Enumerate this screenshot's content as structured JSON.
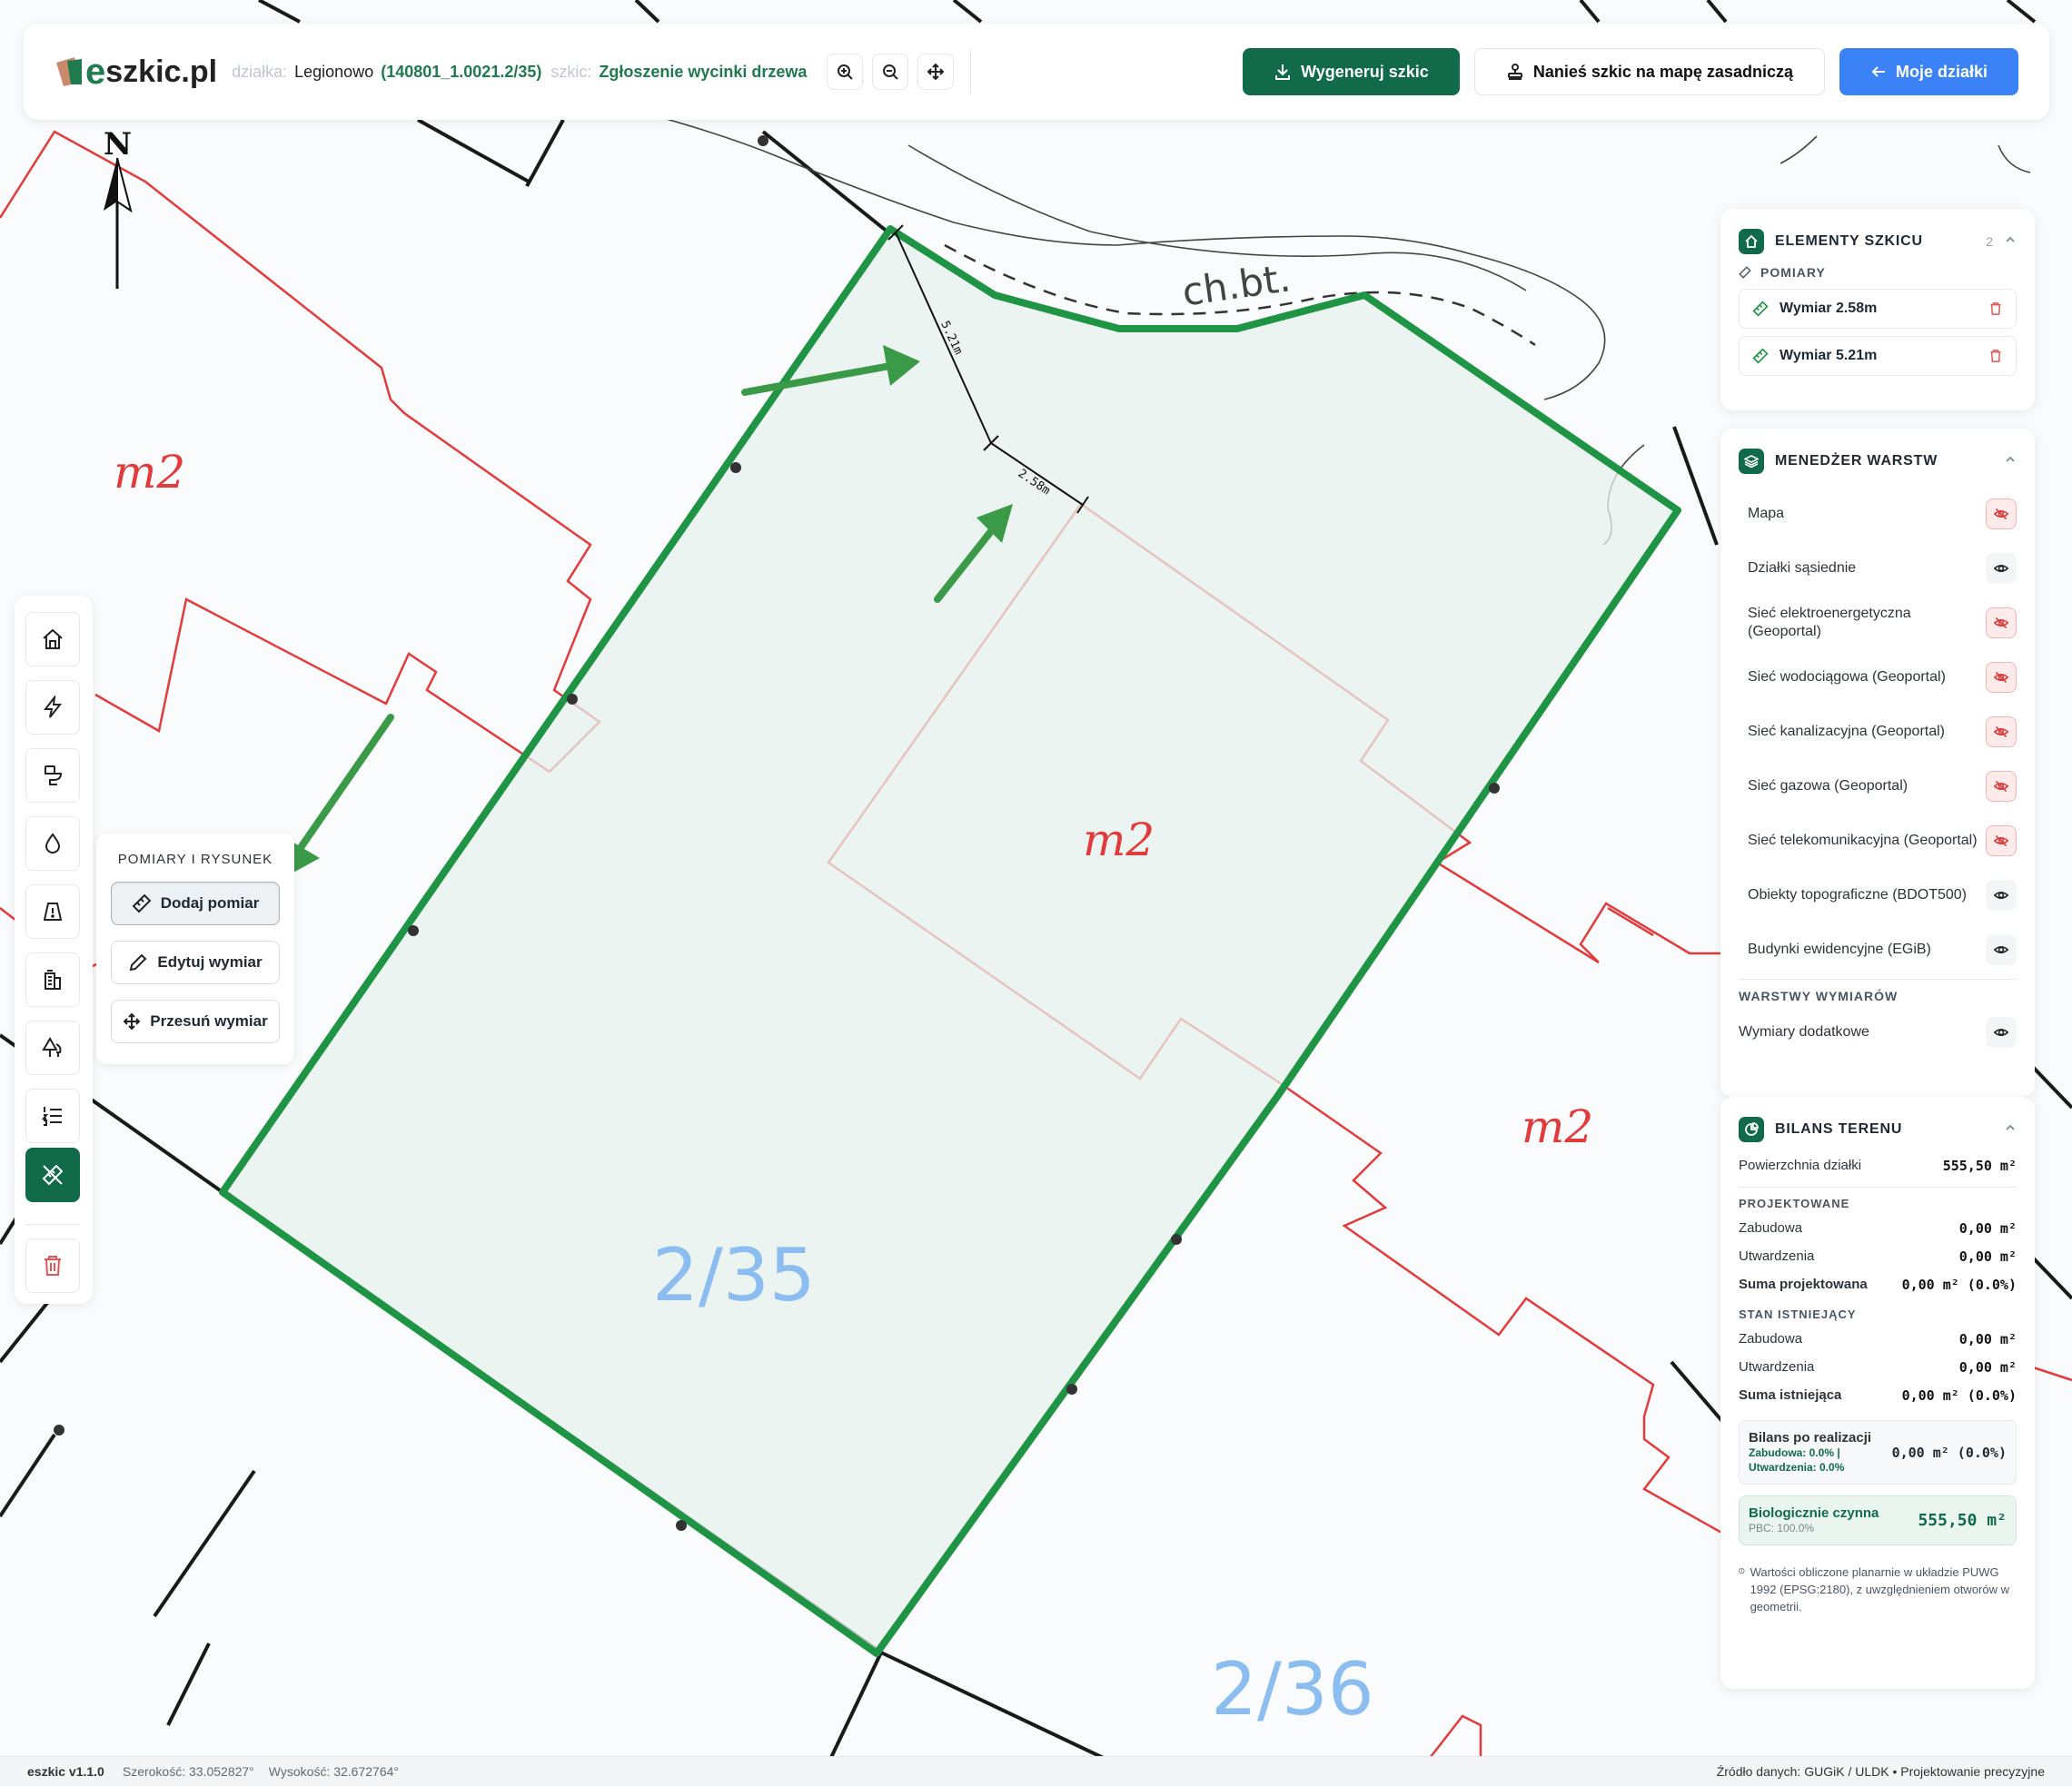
{
  "app": {
    "logo_text": "szkic.pl",
    "logo_e": "e",
    "parcel_label": "działka:",
    "parcel_town": "Legionowo",
    "parcel_id": "(140801_1.0021.2/35)",
    "sketch_label": "szkic:",
    "sketch_name": "Zgłoszenie wycinki drzewa"
  },
  "toolbar": {
    "generate_label": "Wygeneruj szkic",
    "apply_label": "Nanieś szkic na mapę zasadniczą",
    "my_parcels_label": "Moje działki"
  },
  "map": {
    "north_label": "N",
    "parcel_main": "2/35",
    "parcel_next": "2/36",
    "building_labels": [
      "m2",
      "m2",
      "m2"
    ],
    "hedge_label": "ch.bt.",
    "measure_a": "5.21m",
    "measure_b": "2.58m",
    "colors": {
      "parcel_outline": "#1e9444",
      "parcel_fill": "#e6f2ee",
      "building_line": "#e23b3b",
      "parcel_label": "#8bbdf0",
      "arrow": "#3b9a48"
    }
  },
  "measure_panel": {
    "title": "POMIARY I RYSUNEK",
    "add_label": "Dodaj pomiar",
    "edit_label": "Edytuj wymiar",
    "move_label": "Przesuń wymiar"
  },
  "elements_panel": {
    "title": "ELEMENTY SZKICU",
    "count": "2",
    "section": "POMIARY",
    "items": [
      "Wymiar 2.58m",
      "Wymiar 5.21m"
    ]
  },
  "layers_panel": {
    "title": "MENEDŻER WARSTW",
    "layers": [
      {
        "label": "Mapa",
        "visible": false
      },
      {
        "label": "Działki sąsiednie",
        "visible": true
      },
      {
        "label": "Sieć elektroenergetyczna (Geoportal)",
        "visible": false
      },
      {
        "label": "Sieć wodociągowa (Geoportal)",
        "visible": false
      },
      {
        "label": "Sieć kanalizacyjna (Geoportal)",
        "visible": false
      },
      {
        "label": "Sieć gazowa (Geoportal)",
        "visible": false
      },
      {
        "label": "Sieć telekomunikacyjna (Geoportal)",
        "visible": false
      },
      {
        "label": "Obiekty topograficzne (BDOT500)",
        "visible": true
      },
      {
        "label": "Budynki ewidencyjne (EGiB)",
        "visible": true
      }
    ],
    "dims_section": "WARSTWY WYMIARÓW",
    "dims_layer": "Wymiary dodatkowe"
  },
  "balance_panel": {
    "title": "BILANS TERENU",
    "area_label": "Powierzchnia działki",
    "area_value": "555,50 m²",
    "projected_title": "PROJEKTOWANE",
    "projected": [
      {
        "k": "Zabudowa",
        "v": "0,00 m²"
      },
      {
        "k": "Utwardzenia",
        "v": "0,00 m²"
      },
      {
        "k": "Suma projektowana",
        "v": "0,00 m² (0.0%)"
      }
    ],
    "existing_title": "STAN ISTNIEJĄCY",
    "existing": [
      {
        "k": "Zabudowa",
        "v": "0,00 m²"
      },
      {
        "k": "Utwardzenia",
        "v": "0,00 m²"
      },
      {
        "k": "Suma istniejąca",
        "v": "0,00 m² (0.0%)"
      }
    ],
    "after_title": "Bilans po realizacji",
    "after_sub1": "Zabudowa: 0.0% |",
    "after_sub2": "Utwardzenia: 0.0%",
    "after_value": "0,00 m² (0.0%)",
    "bio_title": "Biologicznie czynna",
    "bio_sub": "PBC: 100.0%",
    "bio_value": "555,50 m²",
    "note": "Wartości obliczone planarnie w układzie PUWG 1992 (EPSG:2180), z uwzględnieniem otworów w geometrii."
  },
  "footer": {
    "version": "eszkic v1.1.0",
    "lat": "Szerokość: 33.052827°",
    "lon": "Wysokość: 32.672764°",
    "source": "Źródło danych: GUGiK / ULDK • Projektowanie precyzyjne"
  }
}
